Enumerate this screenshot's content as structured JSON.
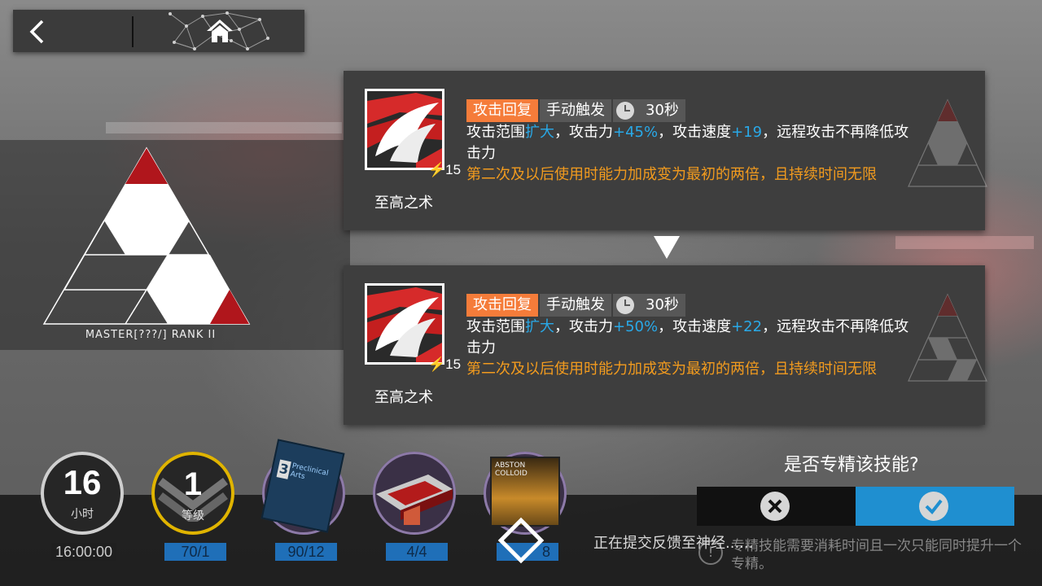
{
  "skill_name": "至高之术",
  "sp_cost": "15",
  "emblem_label": "MASTER[???/] RANK II",
  "current": {
    "tags": {
      "type": "攻击回复",
      "trigger": "手动触发",
      "duration": "30秒"
    },
    "desc": {
      "p1": "攻击范围",
      "expand": "扩大",
      "p2": "，攻击力",
      "atk": "+45%",
      "p3": "，攻击速度",
      "aspd": "+19",
      "p4": "，远程攻击不再降低攻击力",
      "extra": "第二次及以后使用时能力加成变为最初的两倍，且持续时间无限"
    }
  },
  "next": {
    "tags": {
      "type": "攻击回复",
      "trigger": "手动触发",
      "duration": "30秒"
    },
    "desc": {
      "p1": "攻击范围",
      "expand": "扩大",
      "p2": "，攻击力",
      "atk": "+50%",
      "p3": "，攻击速度",
      "aspd": "+22",
      "p4": "，远程攻击不再降低攻击力",
      "extra": "第二次及以后使用时能力加成变为最初的两倍，且持续时间无限"
    }
  },
  "confirm": {
    "question": "是否专精该技能?"
  },
  "costs": {
    "hours": {
      "value": "16",
      "label": "小时",
      "time": "16:00:00"
    },
    "level": {
      "value": "1",
      "label": "等级",
      "req": "70/1"
    },
    "item1": {
      "name": "Preclinical Arts",
      "count": "90/12"
    },
    "item2": {
      "count": "4/4"
    },
    "item3": {
      "name": "ABSTON COLLOID",
      "count": "8"
    }
  },
  "status_text": "正在提交反馈至神经......",
  "hint": "专精技能需要消耗时间且一次只能同时提升一个专精。",
  "colors": {
    "accent_blue": "#1f8fd0",
    "tag_orange": "#f57c3a",
    "value_blue": "#29a9e8",
    "extra_orange": "#f29b1e"
  }
}
